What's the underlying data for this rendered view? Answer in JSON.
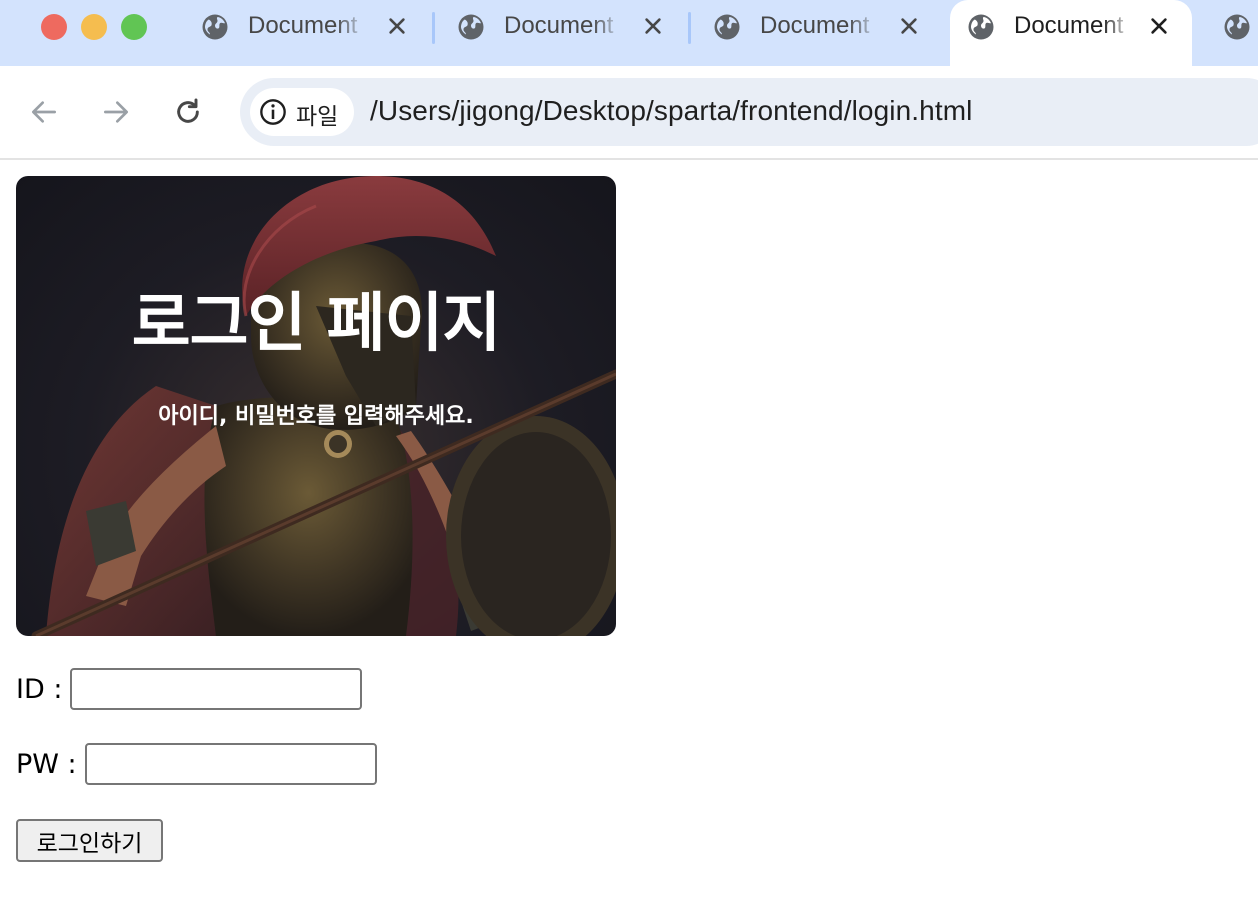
{
  "browser": {
    "tabs": [
      {
        "title": "Document",
        "active": false
      },
      {
        "title": "Document",
        "active": false
      },
      {
        "title": "Document",
        "active": false
      },
      {
        "title": "Document",
        "active": true
      }
    ],
    "site_chip_label": "파일",
    "url": "/Users/jigong/Desktop/sparta/frontend/login.html",
    "colors": {
      "tabstrip": "#d3e3fd",
      "omnibox": "#e9eef6",
      "traffic_red": "#ee6a5f",
      "traffic_yellow": "#f5bd4f",
      "traffic_green": "#61c554"
    },
    "icons": [
      "back-arrow-icon",
      "forward-arrow-icon",
      "reload-icon",
      "info-icon",
      "globe-icon",
      "close-icon"
    ]
  },
  "page": {
    "hero": {
      "title": "로그인 페이지",
      "subtitle": "아이디, 비밀번호를 입력해주세요."
    },
    "form": {
      "id_label": "ID :",
      "id_value": "",
      "pw_label": "PW :",
      "pw_value": "",
      "submit_label": "로그인하기"
    }
  }
}
